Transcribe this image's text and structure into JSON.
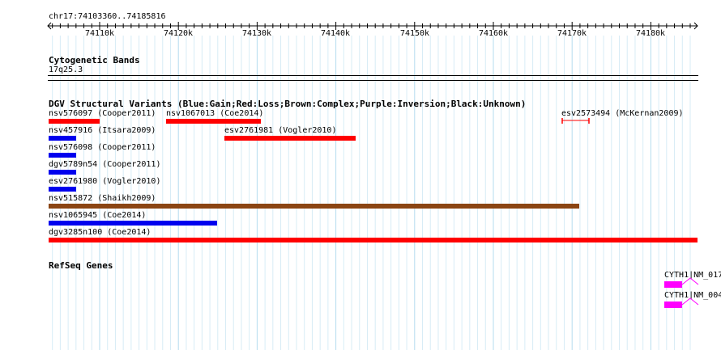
{
  "ruler": {
    "location": "chr17:74103360..74185816",
    "ticks": [
      "74110k",
      "74120k",
      "74130k",
      "74140k",
      "74150k",
      "74160k",
      "74170k",
      "74180k"
    ]
  },
  "tracks": {
    "cytobands": {
      "title": "Cytogenetic Bands",
      "band": "17q25.3"
    },
    "dgv": {
      "title": "DGV Structural Variants (Blue:Gain;Red:Loss;Brown:Complex;Purple:Inversion;Black:Unknown)",
      "colors": {
        "gain": "#0000ee",
        "loss": "#ff0000",
        "complex": "#8b4513"
      },
      "variants": [
        {
          "label": "nsv576097 (Cooper2011)",
          "type": "loss"
        },
        {
          "label": "nsv1067013 (Coe2014)",
          "type": "loss"
        },
        {
          "label": "esv2573494 (McKernan2009)",
          "type": "loss"
        },
        {
          "label": "nsv457916 (Itsara2009)",
          "type": "gain"
        },
        {
          "label": "esv2761981 (Vogler2010)",
          "type": "loss"
        },
        {
          "label": "nsv576098 (Cooper2011)",
          "type": "gain"
        },
        {
          "label": "dgv5789n54 (Cooper2011)",
          "type": "gain"
        },
        {
          "label": "esv2761980 (Vogler2010)",
          "type": "gain"
        },
        {
          "label": "nsv515872 (Shaikh2009)",
          "type": "complex"
        },
        {
          "label": "nsv1065945 (Coe2014)",
          "type": "gain"
        },
        {
          "label": "dgv3285n100 (Coe2014)",
          "type": "loss"
        }
      ]
    },
    "refseq": {
      "title": "RefSeq Genes",
      "color": "#ff00ff",
      "genes": [
        {
          "label": "CYTH1|NM_017"
        },
        {
          "label": "CYTH1|NM_004"
        }
      ]
    }
  }
}
